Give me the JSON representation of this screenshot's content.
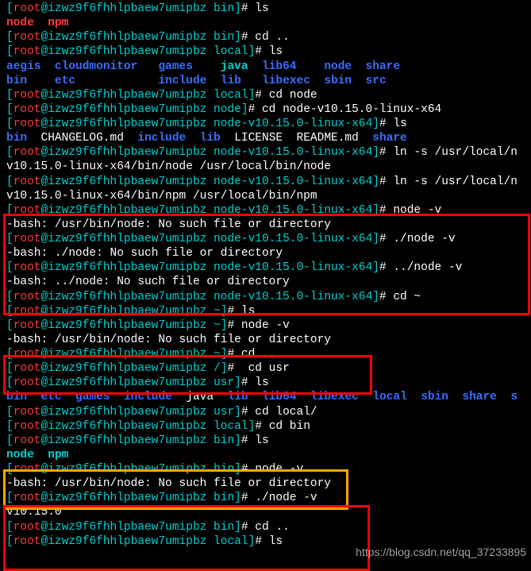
{
  "host": "izwz9f6fhhlpbaew7umipbz",
  "user": "root",
  "watermark": "https://blog.csdn.net/qq_37233895",
  "lines": [
    {
      "t": "prompt",
      "path": "bin",
      "cmd": "ls"
    },
    {
      "t": "ls",
      "items": [
        {
          "n": "node",
          "c": "red-b"
        },
        {
          "n": "  ",
          "c": "out"
        },
        {
          "n": "npm",
          "c": "red-b"
        }
      ]
    },
    {
      "t": "prompt",
      "path": "bin",
      "cmd": "cd .."
    },
    {
      "t": "prompt",
      "path": "local",
      "cmd": "ls"
    },
    {
      "t": "ls",
      "items": [
        {
          "n": "aegis",
          "c": "blue-b"
        },
        {
          "n": "  ",
          "c": "out"
        },
        {
          "n": "cloudmonitor",
          "c": "blue-b"
        },
        {
          "n": "   ",
          "c": "out"
        },
        {
          "n": "games",
          "c": "blue-b"
        },
        {
          "n": "    ",
          "c": "out"
        },
        {
          "n": "java",
          "c": "cyan-b"
        },
        {
          "n": "  ",
          "c": "out"
        },
        {
          "n": "lib64",
          "c": "blue-b"
        },
        {
          "n": "    ",
          "c": "out"
        },
        {
          "n": "node",
          "c": "blue-b"
        },
        {
          "n": "  ",
          "c": "out"
        },
        {
          "n": "share",
          "c": "blue-b"
        }
      ]
    },
    {
      "t": "ls",
      "items": [
        {
          "n": "bin",
          "c": "blue-b"
        },
        {
          "n": "    ",
          "c": "out"
        },
        {
          "n": "etc",
          "c": "blue-b"
        },
        {
          "n": "            ",
          "c": "out"
        },
        {
          "n": "include",
          "c": "blue-b"
        },
        {
          "n": "  ",
          "c": "out"
        },
        {
          "n": "lib",
          "c": "blue-b"
        },
        {
          "n": "   ",
          "c": "out"
        },
        {
          "n": "libexec",
          "c": "blue-b"
        },
        {
          "n": "  ",
          "c": "out"
        },
        {
          "n": "sbin",
          "c": "blue-b"
        },
        {
          "n": "  ",
          "c": "out"
        },
        {
          "n": "src",
          "c": "blue-b"
        }
      ]
    },
    {
      "t": "prompt",
      "path": "local",
      "cmd": "cd node"
    },
    {
      "t": "prompt",
      "path": "node",
      "cmd": "cd node-v10.15.0-linux-x64"
    },
    {
      "t": "prompt",
      "path": "node-v10.15.0-linux-x64",
      "cmd": "ls"
    },
    {
      "t": "ls",
      "items": [
        {
          "n": "bin",
          "c": "blue-b"
        },
        {
          "n": "  ",
          "c": "out"
        },
        {
          "n": "CHANGELOG.md",
          "c": "out"
        },
        {
          "n": "  ",
          "c": "out"
        },
        {
          "n": "include",
          "c": "blue-b"
        },
        {
          "n": "  ",
          "c": "out"
        },
        {
          "n": "lib",
          "c": "blue-b"
        },
        {
          "n": "  ",
          "c": "out"
        },
        {
          "n": "LICENSE",
          "c": "out"
        },
        {
          "n": "  ",
          "c": "out"
        },
        {
          "n": "README.md",
          "c": "out"
        },
        {
          "n": "  ",
          "c": "out"
        },
        {
          "n": "share",
          "c": "blue-b"
        }
      ]
    },
    {
      "t": "prompt",
      "path": "node-v10.15.0-linux-x64",
      "cmd": "ln -s /usr/local/n"
    },
    {
      "t": "out",
      "text": "v10.15.0-linux-x64/bin/node /usr/local/bin/node"
    },
    {
      "t": "prompt",
      "path": "node-v10.15.0-linux-x64",
      "cmd": "ln -s /usr/local/n"
    },
    {
      "t": "out",
      "text": "v10.15.0-linux-x64/bin/npm /usr/local/bin/npm"
    },
    {
      "t": "prompt",
      "path": "node-v10.15.0-linux-x64",
      "cmd": "node -v"
    },
    {
      "t": "out",
      "text": "-bash: /usr/bin/node: No such file or directory"
    },
    {
      "t": "prompt",
      "path": "node-v10.15.0-linux-x64",
      "cmd": "./node -v"
    },
    {
      "t": "out",
      "text": "-bash: ./node: No such file or directory"
    },
    {
      "t": "prompt",
      "path": "node-v10.15.0-linux-x64",
      "cmd": "../node -v"
    },
    {
      "t": "out",
      "text": "-bash: ../node: No such file or directory"
    },
    {
      "t": "prompt",
      "path": "node-v10.15.0-linux-x64",
      "cmd": "cd ~"
    },
    {
      "t": "prompt",
      "path": "~",
      "cmd": "ls"
    },
    {
      "t": "prompt",
      "path": "~",
      "cmd": "node -v"
    },
    {
      "t": "out",
      "text": "-bash: /usr/bin/node: No such file or directory"
    },
    {
      "t": "prompt",
      "path": "~",
      "cmd": "cd .."
    },
    {
      "t": "prompt",
      "path": "/",
      "cmd": " cd usr"
    },
    {
      "t": "prompt",
      "path": "usr",
      "cmd": "ls"
    },
    {
      "t": "ls",
      "items": [
        {
          "n": "bin",
          "c": "blue-b"
        },
        {
          "n": "  ",
          "c": "out"
        },
        {
          "n": "etc",
          "c": "blue-b"
        },
        {
          "n": "  ",
          "c": "out"
        },
        {
          "n": "games",
          "c": "blue-b"
        },
        {
          "n": "  ",
          "c": "out"
        },
        {
          "n": "include",
          "c": "blue-b"
        },
        {
          "n": "  ",
          "c": "out"
        },
        {
          "n": "java",
          "c": "out"
        },
        {
          "n": "  ",
          "c": "out"
        },
        {
          "n": "lib",
          "c": "blue-b"
        },
        {
          "n": "  ",
          "c": "out"
        },
        {
          "n": "lib64",
          "c": "blue-b"
        },
        {
          "n": "  ",
          "c": "out"
        },
        {
          "n": "libexec",
          "c": "blue-b"
        },
        {
          "n": "  ",
          "c": "out"
        },
        {
          "n": "local",
          "c": "blue-b"
        },
        {
          "n": "  ",
          "c": "out"
        },
        {
          "n": "sbin",
          "c": "blue-b"
        },
        {
          "n": "  ",
          "c": "out"
        },
        {
          "n": "share",
          "c": "blue-b"
        },
        {
          "n": "  ",
          "c": "out"
        },
        {
          "n": "s",
          "c": "blue-b"
        }
      ]
    },
    {
      "t": "prompt",
      "path": "usr",
      "cmd": "cd local/"
    },
    {
      "t": "prompt",
      "path": "local",
      "cmd": "cd bin"
    },
    {
      "t": "prompt",
      "path": "bin",
      "cmd": "ls"
    },
    {
      "t": "ls",
      "items": [
        {
          "n": "node",
          "c": "cyan-b"
        },
        {
          "n": "  ",
          "c": "out"
        },
        {
          "n": "npm",
          "c": "cyan-b"
        }
      ]
    },
    {
      "t": "prompt",
      "path": "bin",
      "cmd": "node -v"
    },
    {
      "t": "out",
      "text": "-bash: /usr/bin/node: No such file or directory"
    },
    {
      "t": "prompt",
      "path": "bin",
      "cmd": "./node -v"
    },
    {
      "t": "out",
      "text": "v10.15.0"
    },
    {
      "t": "prompt",
      "path": "bin",
      "cmd": "cd .."
    },
    {
      "t": "prompt",
      "path": "local",
      "cmd": "ls"
    }
  ]
}
